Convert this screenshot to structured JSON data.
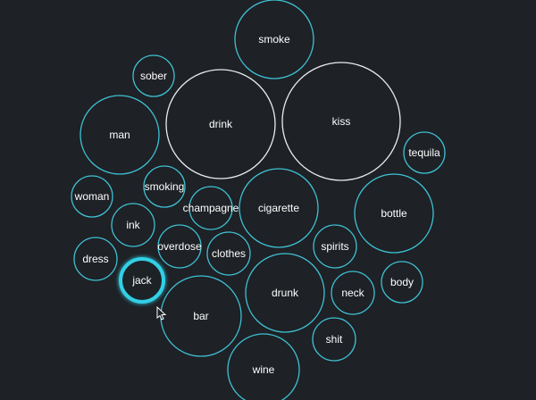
{
  "colors": {
    "background": "#1e2126",
    "outline_white": "#e9edf0",
    "outline_cyan": "#3ec1d3",
    "active_glow": "#31d0e6"
  },
  "bubbles": [
    {
      "id": "smoke",
      "label": "smoke",
      "style": "cyan"
    },
    {
      "id": "sober",
      "label": "sober",
      "style": "cyan"
    },
    {
      "id": "drink",
      "label": "drink",
      "style": "white"
    },
    {
      "id": "kiss",
      "label": "kiss",
      "style": "white"
    },
    {
      "id": "man",
      "label": "man",
      "style": "cyan"
    },
    {
      "id": "tequila",
      "label": "tequila",
      "style": "cyan"
    },
    {
      "id": "woman",
      "label": "woman",
      "style": "cyan"
    },
    {
      "id": "smoking",
      "label": "smoking",
      "style": "cyan"
    },
    {
      "id": "champagne",
      "label": "champagne",
      "style": "cyan"
    },
    {
      "id": "cigarette",
      "label": "cigarette",
      "style": "cyan"
    },
    {
      "id": "bottle",
      "label": "bottle",
      "style": "cyan"
    },
    {
      "id": "ink",
      "label": "ink",
      "style": "cyan"
    },
    {
      "id": "overdose",
      "label": "overdose",
      "style": "cyan"
    },
    {
      "id": "clothes",
      "label": "clothes",
      "style": "cyan"
    },
    {
      "id": "spirits",
      "label": "spirits",
      "style": "cyan"
    },
    {
      "id": "dress",
      "label": "dress",
      "style": "cyan"
    },
    {
      "id": "jack",
      "label": "jack",
      "style": "cyan",
      "active": true
    },
    {
      "id": "drunk",
      "label": "drunk",
      "style": "cyan"
    },
    {
      "id": "neck",
      "label": "neck",
      "style": "cyan"
    },
    {
      "id": "body",
      "label": "body",
      "style": "cyan"
    },
    {
      "id": "bar",
      "label": "bar",
      "style": "cyan"
    },
    {
      "id": "shit",
      "label": "shit",
      "style": "cyan"
    },
    {
      "id": "wine",
      "label": "wine",
      "style": "cyan"
    }
  ]
}
